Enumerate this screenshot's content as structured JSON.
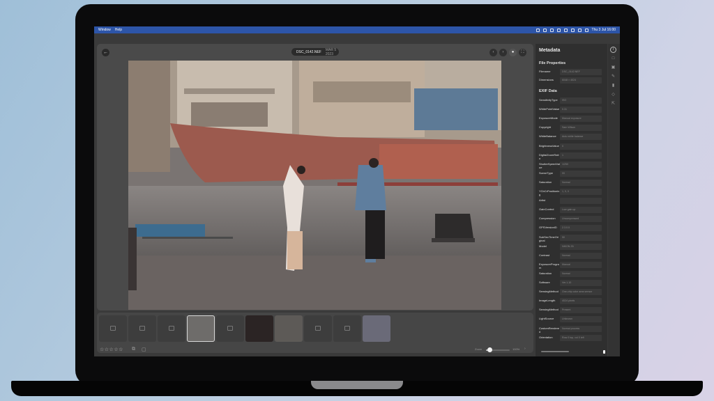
{
  "menubar": {
    "app_menu": "Window",
    "help_menu": "Help",
    "clock": "Thu 3 Jul 16:00"
  },
  "toolbar": {
    "back_icon": "arrow-left-icon",
    "file_name": "DSC_0142.NEF",
    "file_date": "MAR 5 2023"
  },
  "filmstrip": {
    "thumbnails": [
      {
        "state": "placeholder"
      },
      {
        "state": "placeholder"
      },
      {
        "state": "placeholder"
      },
      {
        "state": "selected"
      },
      {
        "state": "placeholder"
      },
      {
        "state": "image"
      },
      {
        "state": "image"
      },
      {
        "state": "placeholder"
      },
      {
        "state": "placeholder"
      },
      {
        "state": "image"
      }
    ]
  },
  "footer": {
    "rating": "☆☆☆☆☆",
    "zoom_label": "Zoom",
    "zoom_value": "100%",
    "zoom_level": 0.1
  },
  "panel": {
    "title": "Metadata",
    "file_properties": {
      "heading": "File Properties",
      "rows": [
        {
          "key": "Filename",
          "value": "DSC_0142.NEF"
        },
        {
          "key": "Dimensions",
          "value": "6048 × 4024"
        }
      ]
    },
    "exif": {
      "heading": "EXIF Data",
      "rows": [
        {
          "key": "SensitivityType",
          "value": "ISO"
        },
        {
          "key": "WhitePointValue",
          "value": "0.31"
        },
        {
          "key": "ExposureMode",
          "value": "Manual exposure"
        },
        {
          "key": "Copyright",
          "value": "Sam Wilson"
        },
        {
          "key": "WhiteBalance",
          "value": "Auto white balance"
        },
        {
          "key": "BrightnessValue",
          "value": "0"
        },
        {
          "key": "DigitalZoomRatio",
          "value": "1"
        },
        {
          "key": "ShutterSpeedValue",
          "value": "1/250"
        },
        {
          "key": "SceneType",
          "value": "00"
        },
        {
          "key": "Saturation",
          "value": "Normal"
        },
        {
          "key": "YCbCrPositioning",
          "value": "1, 0, 0"
        },
        {
          "key": "Artist",
          "value": ""
        },
        {
          "key": "GainControl",
          "value": "Low gain up"
        },
        {
          "key": "Compression",
          "value": "Uncompressed"
        },
        {
          "key": "GPSVersionID",
          "value": "2.3.0.0"
        },
        {
          "key": "SubSecTimeOriginal",
          "value": "50"
        },
        {
          "key": "Model",
          "value": "NIKON Z6"
        },
        {
          "key": "Contrast",
          "value": "Normal"
        },
        {
          "key": "ExposureProgram",
          "value": "Manual"
        },
        {
          "key": "Saturation",
          "value": "Normal"
        },
        {
          "key": "Software",
          "value": "Ver.1.10"
        },
        {
          "key": "SensingMethod",
          "value": "One-chip color area sensor"
        },
        {
          "key": "ImageLength",
          "value": "4024 pixels"
        },
        {
          "key": "SensingMethod",
          "value": "Present"
        },
        {
          "key": "LightSource",
          "value": "Unknown"
        },
        {
          "key": "CustomRendered",
          "value": "Normal process"
        },
        {
          "key": "Orientation",
          "value": "Row 0 top, col 0 left"
        }
      ]
    }
  },
  "side_rail": {
    "icons": [
      "info-icon",
      "folder-icon",
      "image-icon",
      "edit-icon",
      "bookmark-icon",
      "tag-icon",
      "share-icon"
    ]
  },
  "colors": {
    "menubar": "#2d55a8",
    "app_bg": "#3a3a3a",
    "panel_bg": "#2f2f2f",
    "accent": "#ffffff"
  }
}
